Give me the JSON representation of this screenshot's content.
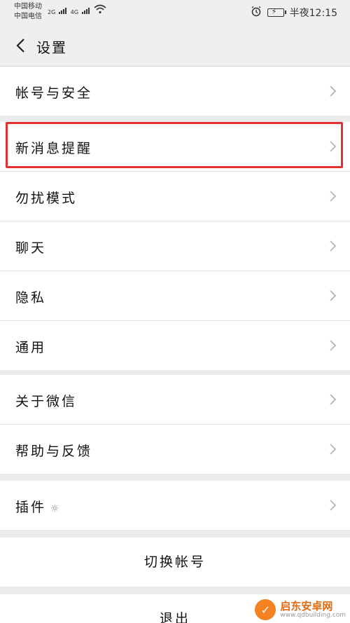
{
  "status_bar": {
    "carrier_1": "中国移动",
    "carrier_2": "中国电信",
    "net_1": "2G",
    "net_2": "4G",
    "time": "半夜12:15",
    "icons": [
      "signal-icon",
      "wifi-icon",
      "alarm-icon",
      "battery-charging-icon"
    ]
  },
  "header": {
    "back_icon": "chevron-left-icon",
    "title": "设置"
  },
  "groups": [
    {
      "items": [
        {
          "label": "帐号与安全"
        }
      ]
    },
    {
      "items": [
        {
          "label": "新消息提醒",
          "highlighted": true
        },
        {
          "label": "勿扰模式"
        },
        {
          "label": "聊天"
        },
        {
          "label": "隐私"
        },
        {
          "label": "通用"
        }
      ]
    },
    {
      "items": [
        {
          "label": "关于微信"
        },
        {
          "label": "帮助与反馈"
        }
      ]
    },
    {
      "items": [
        {
          "label": "插件",
          "icon": "plugin-icon"
        }
      ]
    }
  ],
  "actions": {
    "switch_account": "切换帐号",
    "logout": "退出"
  },
  "watermark": {
    "name": "启东安卓网",
    "url": "www.qdbuilding.com"
  },
  "colors": {
    "highlight": "#e53030",
    "background": "#ececec",
    "watermark": "#f58220"
  }
}
